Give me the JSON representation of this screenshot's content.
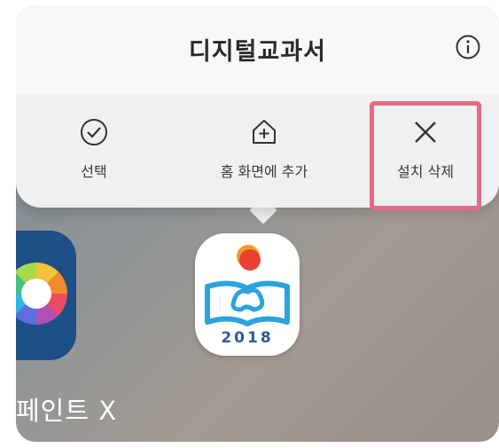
{
  "popup": {
    "title": "디지털교과서",
    "info_icon": "info-circle-icon",
    "actions": [
      {
        "label": "선택",
        "icon": "check-circle-icon"
      },
      {
        "label": "홈 화면에 추가",
        "icon": "home-add-icon"
      },
      {
        "label": "설치 삭제",
        "icon": "close-icon"
      }
    ]
  },
  "apps": {
    "left_label": "페인트 X",
    "main_year": "2018"
  },
  "colors": {
    "highlight": "#e46b84",
    "app_left_bg": "#1e4f86",
    "main_logo_blue": "#2a5b9a"
  }
}
